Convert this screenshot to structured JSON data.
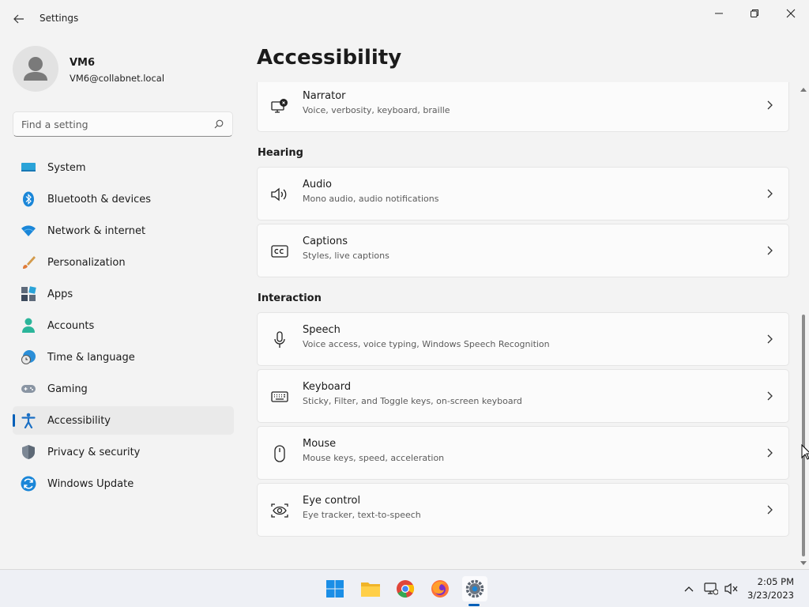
{
  "window": {
    "app_title": "Settings",
    "back_icon": "arrow-left-icon",
    "controls": [
      "minimize-icon",
      "maximize-icon",
      "close-icon"
    ]
  },
  "profile": {
    "name": "VM6",
    "email": "VM6@collabnet.local"
  },
  "search": {
    "placeholder": "Find a setting",
    "value": ""
  },
  "sidebar": {
    "items": [
      {
        "label": "System",
        "icon": "monitor-icon",
        "selected": false
      },
      {
        "label": "Bluetooth & devices",
        "icon": "bluetooth-icon",
        "selected": false
      },
      {
        "label": "Network & internet",
        "icon": "wifi-icon",
        "selected": false
      },
      {
        "label": "Personalization",
        "icon": "paintbrush-icon",
        "selected": false
      },
      {
        "label": "Apps",
        "icon": "apps-icon",
        "selected": false
      },
      {
        "label": "Accounts",
        "icon": "person-icon",
        "selected": false
      },
      {
        "label": "Time & language",
        "icon": "globe-clock-icon",
        "selected": false
      },
      {
        "label": "Gaming",
        "icon": "gamepad-icon",
        "selected": false
      },
      {
        "label": "Accessibility",
        "icon": "accessibility-icon",
        "selected": true
      },
      {
        "label": "Privacy & security",
        "icon": "shield-icon",
        "selected": false
      },
      {
        "label": "Windows Update",
        "icon": "update-icon",
        "selected": false
      }
    ]
  },
  "main": {
    "title": "Accessibility",
    "cards_top": [
      {
        "title": "Narrator",
        "subtitle": "Voice, verbosity, keyboard, braille",
        "icon": "narrator-icon"
      }
    ],
    "sections": [
      {
        "header": "Hearing",
        "cards": [
          {
            "title": "Audio",
            "subtitle": "Mono audio, audio notifications",
            "icon": "speaker-icon"
          },
          {
            "title": "Captions",
            "subtitle": "Styles, live captions",
            "icon": "captions-icon"
          }
        ]
      },
      {
        "header": "Interaction",
        "cards": [
          {
            "title": "Speech",
            "subtitle": "Voice access, voice typing, Windows Speech Recognition",
            "icon": "microphone-icon"
          },
          {
            "title": "Keyboard",
            "subtitle": "Sticky, Filter, and Toggle keys, on-screen keyboard",
            "icon": "keyboard-icon"
          },
          {
            "title": "Mouse",
            "subtitle": "Mouse keys, speed, acceleration",
            "icon": "mouse-icon"
          },
          {
            "title": "Eye control",
            "subtitle": "Eye tracker, text-to-speech",
            "icon": "eye-control-icon"
          }
        ]
      }
    ]
  },
  "taskbar": {
    "apps": [
      "start-icon",
      "file-explorer-icon",
      "chrome-icon",
      "firefox-icon",
      "settings-icon"
    ],
    "active_app": "settings-icon",
    "tray": [
      "chevron-up-icon",
      "network-icon",
      "volume-muted-icon"
    ],
    "time": "2:05 PM",
    "date": "3/23/2023"
  },
  "colors": {
    "accent": "#005fb8",
    "background": "#f3f3f3",
    "card": "#fbfbfb"
  }
}
